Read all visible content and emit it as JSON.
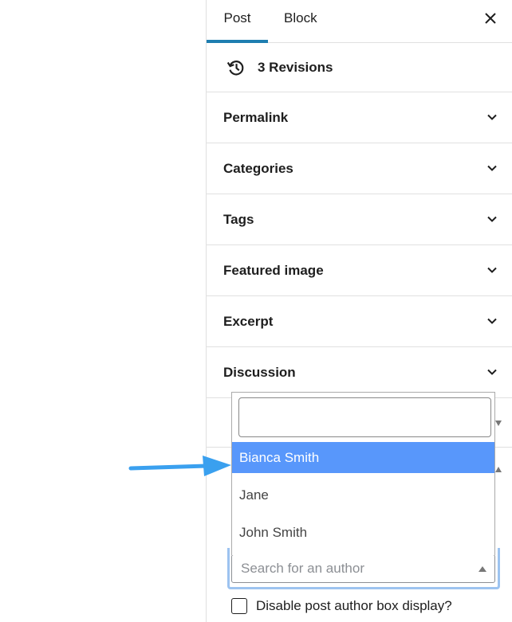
{
  "tabs": {
    "post": "Post",
    "block": "Block",
    "close_icon": "close-icon"
  },
  "revisions": {
    "label": "3 Revisions",
    "icon": "history-icon"
  },
  "panels": [
    {
      "label": "Permalink"
    },
    {
      "label": "Categories"
    },
    {
      "label": "Tags"
    },
    {
      "label": "Featured image"
    },
    {
      "label": "Excerpt"
    },
    {
      "label": "Discussion"
    }
  ],
  "author_dropdown": {
    "search_value": "",
    "options": [
      "Bianca Smith",
      "Jane",
      "John Smith"
    ],
    "highlighted": "Bianca Smith"
  },
  "author_select": {
    "placeholder": "Search for an author"
  },
  "checkbox": {
    "label": "Disable post author box display?",
    "checked": false
  },
  "colors": {
    "accent": "#1e7eb0",
    "highlight": "#5897fb",
    "arrow": "#3aa0ef",
    "focus": "#9dc3f0"
  }
}
